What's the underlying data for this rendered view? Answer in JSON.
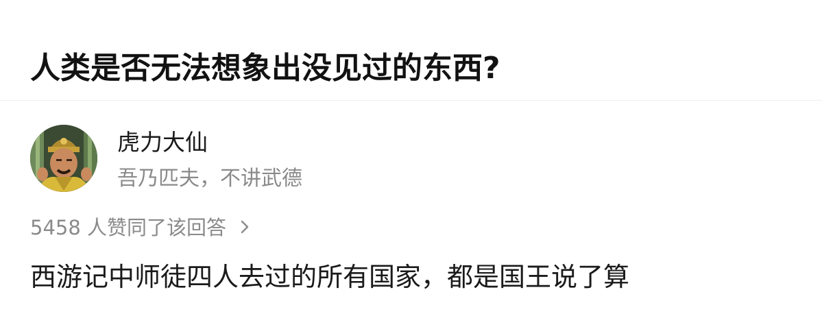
{
  "question": {
    "title": "人类是否无法想象出没见过的东西?"
  },
  "author": {
    "name": "虎力大仙",
    "bio": "吾乃匹夫，不讲武德",
    "avatar_icon": "avatar-portrait"
  },
  "answer": {
    "vote_text": "5458 人赞同了该回答",
    "vote_icon": "chevron-right-icon",
    "content": "西游记中师徒四人去过的所有国家，都是国王说了算"
  },
  "colors": {
    "title": "#121212",
    "muted": "#8a8a8a",
    "divider": "#eeeeee"
  }
}
